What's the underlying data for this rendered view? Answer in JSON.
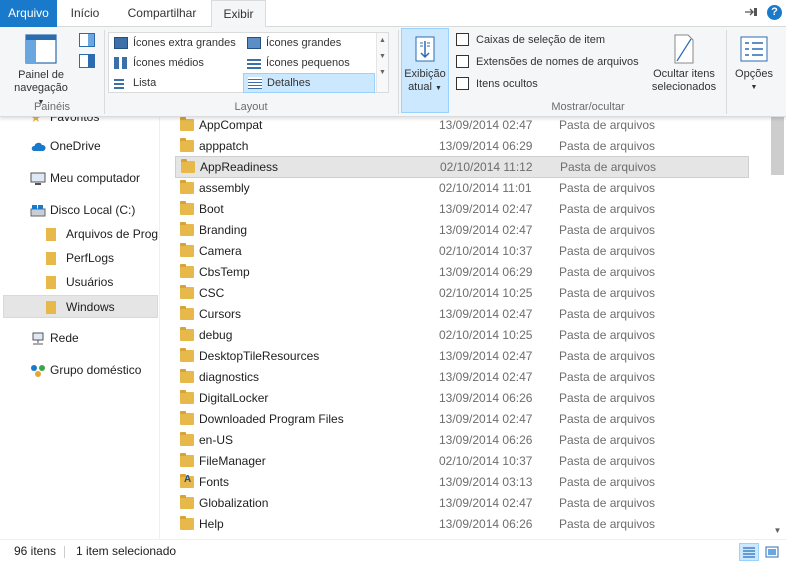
{
  "tabs": {
    "file": "Arquivo",
    "home": "Início",
    "share": "Compartilhar",
    "view": "Exibir"
  },
  "ribbon": {
    "panes": {
      "nav_pane_label_1": "Painel de",
      "nav_pane_label_2": "navegação",
      "group_label": "Painéis"
    },
    "layout": {
      "items": [
        {
          "label": "Ícones extra grandes"
        },
        {
          "label": "Ícones grandes"
        },
        {
          "label": "Ícones médios"
        },
        {
          "label": "Ícones pequenos"
        },
        {
          "label": "Lista"
        },
        {
          "label": "Detalhes"
        }
      ],
      "group_label": "Layout"
    },
    "current_view": {
      "label_1": "Exibição",
      "label_2": "atual"
    },
    "show_hide": {
      "item_checkboxes": "Caixas de seleção de item",
      "file_extensions": "Extensões de nomes de arquivos",
      "hidden_items": "Itens ocultos",
      "hide_selected_1": "Ocultar itens",
      "hide_selected_2": "selecionados",
      "group_label": "Mostrar/ocultar"
    },
    "options": {
      "label": "Opções"
    }
  },
  "nav": {
    "favorites_partial": "Favoritos",
    "onedrive": "OneDrive",
    "computer": "Meu computador",
    "local_disk": "Disco Local (C:)",
    "program_files": "Arquivos de Prog",
    "perflogs": "PerfLogs",
    "users": "Usuários",
    "windows": "Windows",
    "network": "Rede",
    "homegroup": "Grupo doméstico"
  },
  "files": [
    {
      "name": "AppCompat",
      "date": "13/09/2014 02:47",
      "type": "Pasta de arquivos"
    },
    {
      "name": "apppatch",
      "date": "13/09/2014 06:29",
      "type": "Pasta de arquivos"
    },
    {
      "name": "AppReadiness",
      "date": "02/10/2014 11:12",
      "type": "Pasta de arquivos"
    },
    {
      "name": "assembly",
      "date": "02/10/2014 11:01",
      "type": "Pasta de arquivos"
    },
    {
      "name": "Boot",
      "date": "13/09/2014 02:47",
      "type": "Pasta de arquivos"
    },
    {
      "name": "Branding",
      "date": "13/09/2014 02:47",
      "type": "Pasta de arquivos"
    },
    {
      "name": "Camera",
      "date": "02/10/2014 10:37",
      "type": "Pasta de arquivos"
    },
    {
      "name": "CbsTemp",
      "date": "13/09/2014 06:29",
      "type": "Pasta de arquivos"
    },
    {
      "name": "CSC",
      "date": "02/10/2014 10:25",
      "type": "Pasta de arquivos"
    },
    {
      "name": "Cursors",
      "date": "13/09/2014 02:47",
      "type": "Pasta de arquivos"
    },
    {
      "name": "debug",
      "date": "02/10/2014 10:25",
      "type": "Pasta de arquivos"
    },
    {
      "name": "DesktopTileResources",
      "date": "13/09/2014 02:47",
      "type": "Pasta de arquivos"
    },
    {
      "name": "diagnostics",
      "date": "13/09/2014 02:47",
      "type": "Pasta de arquivos"
    },
    {
      "name": "DigitalLocker",
      "date": "13/09/2014 06:26",
      "type": "Pasta de arquivos"
    },
    {
      "name": "Downloaded Program Files",
      "date": "13/09/2014 02:47",
      "type": "Pasta de arquivos"
    },
    {
      "name": "en-US",
      "date": "13/09/2014 06:26",
      "type": "Pasta de arquivos"
    },
    {
      "name": "FileManager",
      "date": "02/10/2014 10:37",
      "type": "Pasta de arquivos"
    },
    {
      "name": "Fonts",
      "date": "13/09/2014 03:13",
      "type": "Pasta de arquivos"
    },
    {
      "name": "Globalization",
      "date": "13/09/2014 02:47",
      "type": "Pasta de arquivos"
    },
    {
      "name": "Help",
      "date": "13/09/2014 06:26",
      "type": "Pasta de arquivos"
    }
  ],
  "status": {
    "count": "96 itens",
    "selected": "1 item selecionado"
  },
  "colors": {
    "accent": "#1979ca",
    "folder": "#e7b84a",
    "selection": "#e5e5e5"
  }
}
